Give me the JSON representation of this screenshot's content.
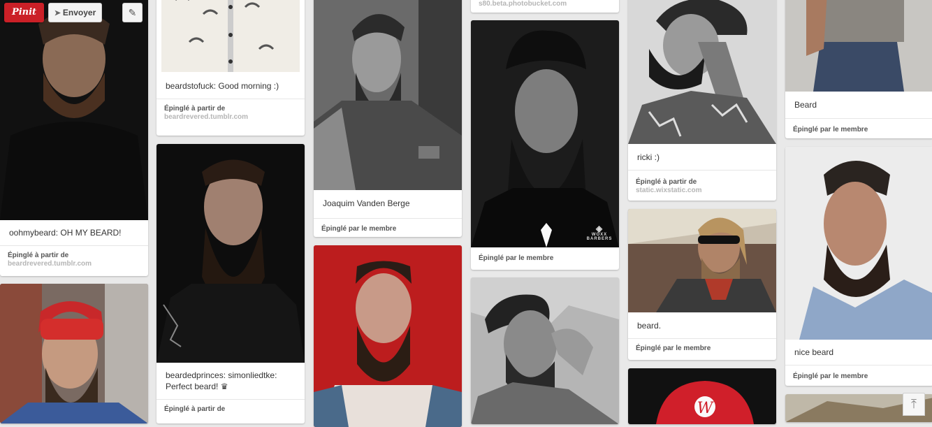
{
  "overlay": {
    "pinit_label": "Pinit",
    "send_label": "Envoyer",
    "send_icon": "paper-plane-icon",
    "edit_icon": "pencil-icon"
  },
  "pins": {
    "c1p1": {
      "description": "oohmybeard: OH MY BEARD!",
      "source_label": "Épinglé à partir de",
      "source_url": "beardrevered.tumblr.com"
    },
    "c2p1": {
      "description": "beardstofuck: Good morning :)",
      "source_label": "Épinglé à partir de",
      "source_url": "beardrevered.tumblr.com"
    },
    "c2p2": {
      "description": "beardedprinces: simonliedtke: Perfect beard! ♛",
      "source_label": "Épinglé à partir de"
    },
    "c3p1": {
      "description": "Joaquim Vanden Berge",
      "source_label": "Épinglé par le membre"
    },
    "c4p0": {
      "source_url": "s80.beta.photobucket.com"
    },
    "c4p1": {
      "source_label": "Épinglé par le membre",
      "watermark": "WOXX BARBERS"
    },
    "c5p1": {
      "description": "ricki :)",
      "source_label": "Épinglé à partir de",
      "source_url": "static.wixstatic.com"
    },
    "c5p2": {
      "description": "beard.",
      "source_label": "Épinglé par le membre"
    },
    "c6p1": {
      "description": "Beard",
      "source_label": "Épinglé par le membre"
    },
    "c6p2": {
      "description": "nice beard",
      "source_label": "Épinglé par le membre"
    }
  },
  "scroll_top_icon": "arrow-up-to-top-icon"
}
